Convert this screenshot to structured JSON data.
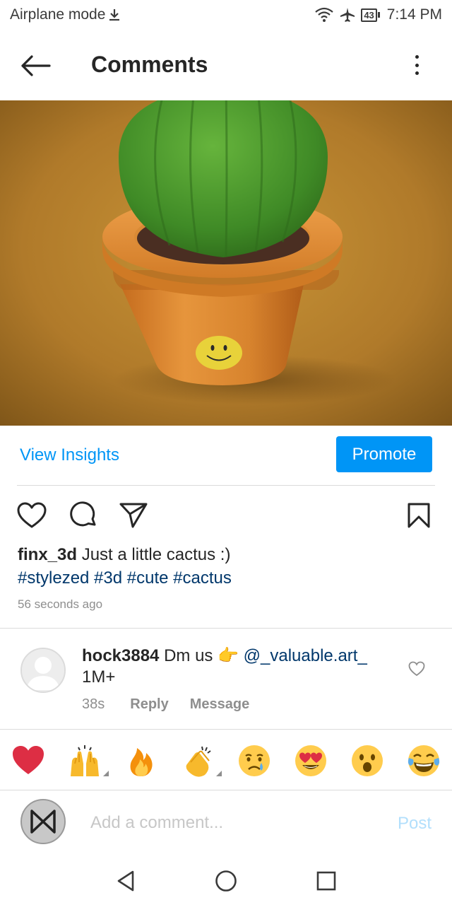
{
  "status_bar": {
    "left_text": "Airplane mode",
    "battery": "43",
    "time": "7:14 PM",
    "icons": [
      "download-icon",
      "wifi-icon",
      "airplane-icon",
      "battery-icon"
    ]
  },
  "app_bar": {
    "title": "Comments",
    "icons": [
      "back-arrow-icon",
      "more-vertical-icon"
    ]
  },
  "post": {
    "image_subject": "cactus-pot-3d-render",
    "insights_label": "View Insights",
    "promote_label": "Promote",
    "action_icons": [
      "heart-icon",
      "comment-icon",
      "share-icon",
      "bookmark-icon"
    ],
    "caption_user": "finx_3d",
    "caption_text": "Just a little cactus :)",
    "hashtags": "#stylezed #3d #cute #cactus",
    "time_ago": "56 seconds ago"
  },
  "comment": {
    "user": "hock3884",
    "text": "Dm us",
    "emoji": "👉",
    "mention": "@_valuable.art_",
    "line2": "1M+",
    "time": "38s",
    "reply_label": "Reply",
    "message_label": "Message"
  },
  "emoji_bar": {
    "items": [
      "❤️",
      "🙌",
      "🔥",
      "👏",
      "😢",
      "😍",
      "😮",
      "😂"
    ]
  },
  "composer": {
    "placeholder": "Add a comment...",
    "post_label": "Post"
  },
  "nav_bar": {
    "icons": [
      "back-triangle-icon",
      "home-circle-icon",
      "recents-square-icon"
    ]
  },
  "colors": {
    "accent": "#0095f6",
    "hashtag": "#00376b",
    "muted": "#8e8e8e",
    "post_disabled": "#b2dffc",
    "background_image": "#b8832e",
    "pot": "#d9842e",
    "cactus": "#4f9a2f"
  }
}
